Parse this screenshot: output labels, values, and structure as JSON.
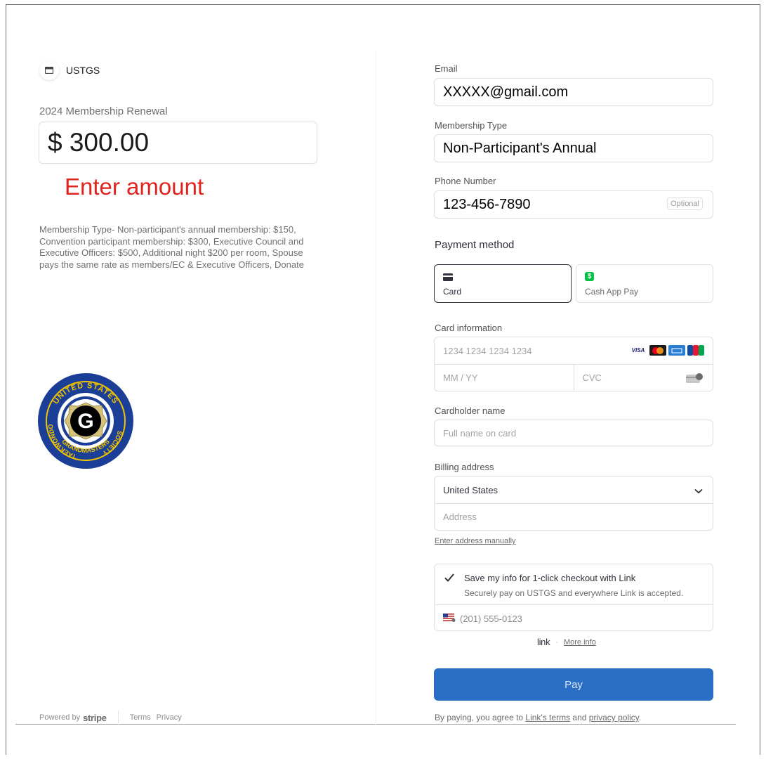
{
  "merchant": {
    "name": "USTGS"
  },
  "product": {
    "name": "2024 Membership Renewal",
    "amount": "$ 300.00",
    "amount_hint": "Enter amount",
    "description": "Membership Type- Non-participant's annual membership: $150, Convention participant membership: $300, Executive Council and Executive Officers: $500, Additional night $200 per room, Spouse pays the same rate as members/EC & Executive Officers, Donate"
  },
  "logo": {
    "icon": "ustgs-seal",
    "top_text": "UNITED STATES",
    "left_text": "TAEKWONDO",
    "bottom_text": "GRANDMASTERS",
    "right_text": "SOCIETY",
    "center_letter": "G"
  },
  "footer": {
    "powered_by": "Powered by",
    "stripe": "stripe",
    "terms": "Terms",
    "privacy": "Privacy"
  },
  "form": {
    "email_label": "Email",
    "email_value": "XXXXX@gmail.com",
    "membership_label": "Membership Type",
    "membership_value": "Non-Participant's Annual",
    "phone_label": "Phone Number",
    "phone_value": "123-456-7890",
    "optional": "Optional"
  },
  "payment": {
    "title": "Payment method",
    "methods": [
      {
        "label": "Card",
        "icon": "card-icon",
        "selected": true
      },
      {
        "label": "Cash App Pay",
        "icon": "cash-app-icon",
        "selected": false
      }
    ],
    "card_info_label": "Card information",
    "card_number_placeholder": "1234 1234 1234 1234",
    "expiry_placeholder": "MM / YY",
    "cvc_placeholder": "CVC",
    "brands": [
      "VISA"
    ],
    "cardholder_label": "Cardholder name",
    "cardholder_placeholder": "Full name on card",
    "billing_label": "Billing address",
    "country": "United States",
    "address_placeholder": "Address",
    "enter_manually": "Enter address manually"
  },
  "link": {
    "save_title": "Save my info for 1-click checkout with Link",
    "save_subtitle": "Securely pay on USTGS and everywhere Link is accepted.",
    "phone_placeholder": "(201) 555-0123",
    "logo_text": "link",
    "separator": "·",
    "more_info": "More info"
  },
  "pay_button": "Pay",
  "terms": {
    "prefix": "By paying, you agree to ",
    "link_terms": "Link's terms",
    "middle": " and ",
    "privacy": "privacy policy",
    "suffix": "."
  },
  "colors": {
    "pay_button": "#2a6ec5",
    "hint_red": "#e0231f",
    "cash_app": "#00c244",
    "seal_blue": "#1b3e96",
    "seal_gold": "#f2c400"
  }
}
